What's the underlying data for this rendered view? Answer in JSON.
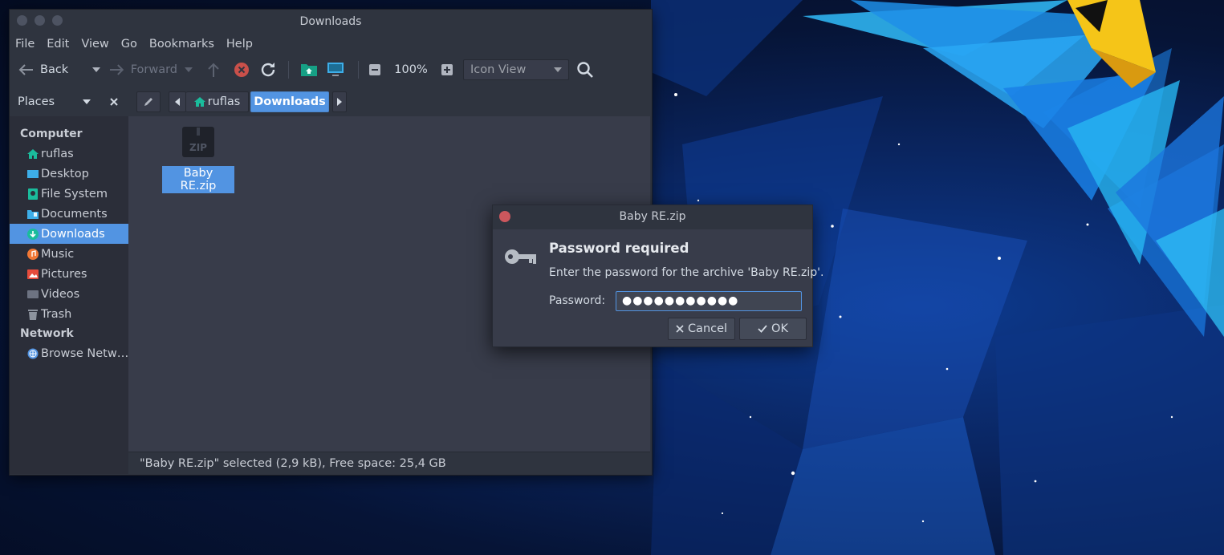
{
  "colors": {
    "accent": "#5294e2",
    "window_bg": "#383c4a",
    "sidebar_bg": "#2b2e39",
    "titlebar_bg": "#2f343f",
    "close": "#cc575d"
  },
  "window": {
    "title": "Downloads"
  },
  "menubar": {
    "items": [
      "File",
      "Edit",
      "View",
      "Go",
      "Bookmarks",
      "Help"
    ]
  },
  "toolbar": {
    "back_label": "Back",
    "forward_label": "Forward",
    "zoom_level": "100%",
    "view_mode": "Icon View"
  },
  "places": {
    "header": "Places",
    "sections": [
      {
        "title": "Computer",
        "items": [
          {
            "label": "ruflas",
            "icon": "home-icon",
            "color": "#1abc9c"
          },
          {
            "label": "Desktop",
            "icon": "desktop-icon",
            "color": "#3daee9"
          },
          {
            "label": "File System",
            "icon": "filesystem-icon",
            "color": "#1abc9c"
          },
          {
            "label": "Documents",
            "icon": "documents-icon",
            "color": "#3daee9"
          },
          {
            "label": "Downloads",
            "icon": "downloads-icon",
            "color": "#1abc9c",
            "selected": true
          },
          {
            "label": "Music",
            "icon": "music-icon",
            "color": "#f27835"
          },
          {
            "label": "Pictures",
            "icon": "pictures-icon",
            "color": "#e74c3c"
          },
          {
            "label": "Videos",
            "icon": "videos-icon",
            "color": "#7f8c9d"
          },
          {
            "label": "Trash",
            "icon": "trash-icon",
            "color": "#8d939e"
          }
        ]
      },
      {
        "title": "Network",
        "items": [
          {
            "label": "Browse Netw…",
            "icon": "network-icon",
            "color": "#5294e2"
          }
        ]
      }
    ]
  },
  "pathbar": {
    "segments": [
      "ruflas",
      "Downloads"
    ]
  },
  "files": [
    {
      "name": "Baby RE.zip",
      "icon": "zip-archive-icon",
      "icon_text": "ZIP",
      "selected": true
    }
  ],
  "statusbar": {
    "text": "\"Baby RE.zip\" selected (2,9 kB), Free space: 25,4 GB"
  },
  "dialog": {
    "title": "Baby RE.zip",
    "heading": "Password required",
    "message": "Enter the password for the archive 'Baby RE.zip'.",
    "password_label": "Password:",
    "password_value": "●●●●●●●●●●●",
    "cancel_label": "Cancel",
    "ok_label": "OK"
  }
}
